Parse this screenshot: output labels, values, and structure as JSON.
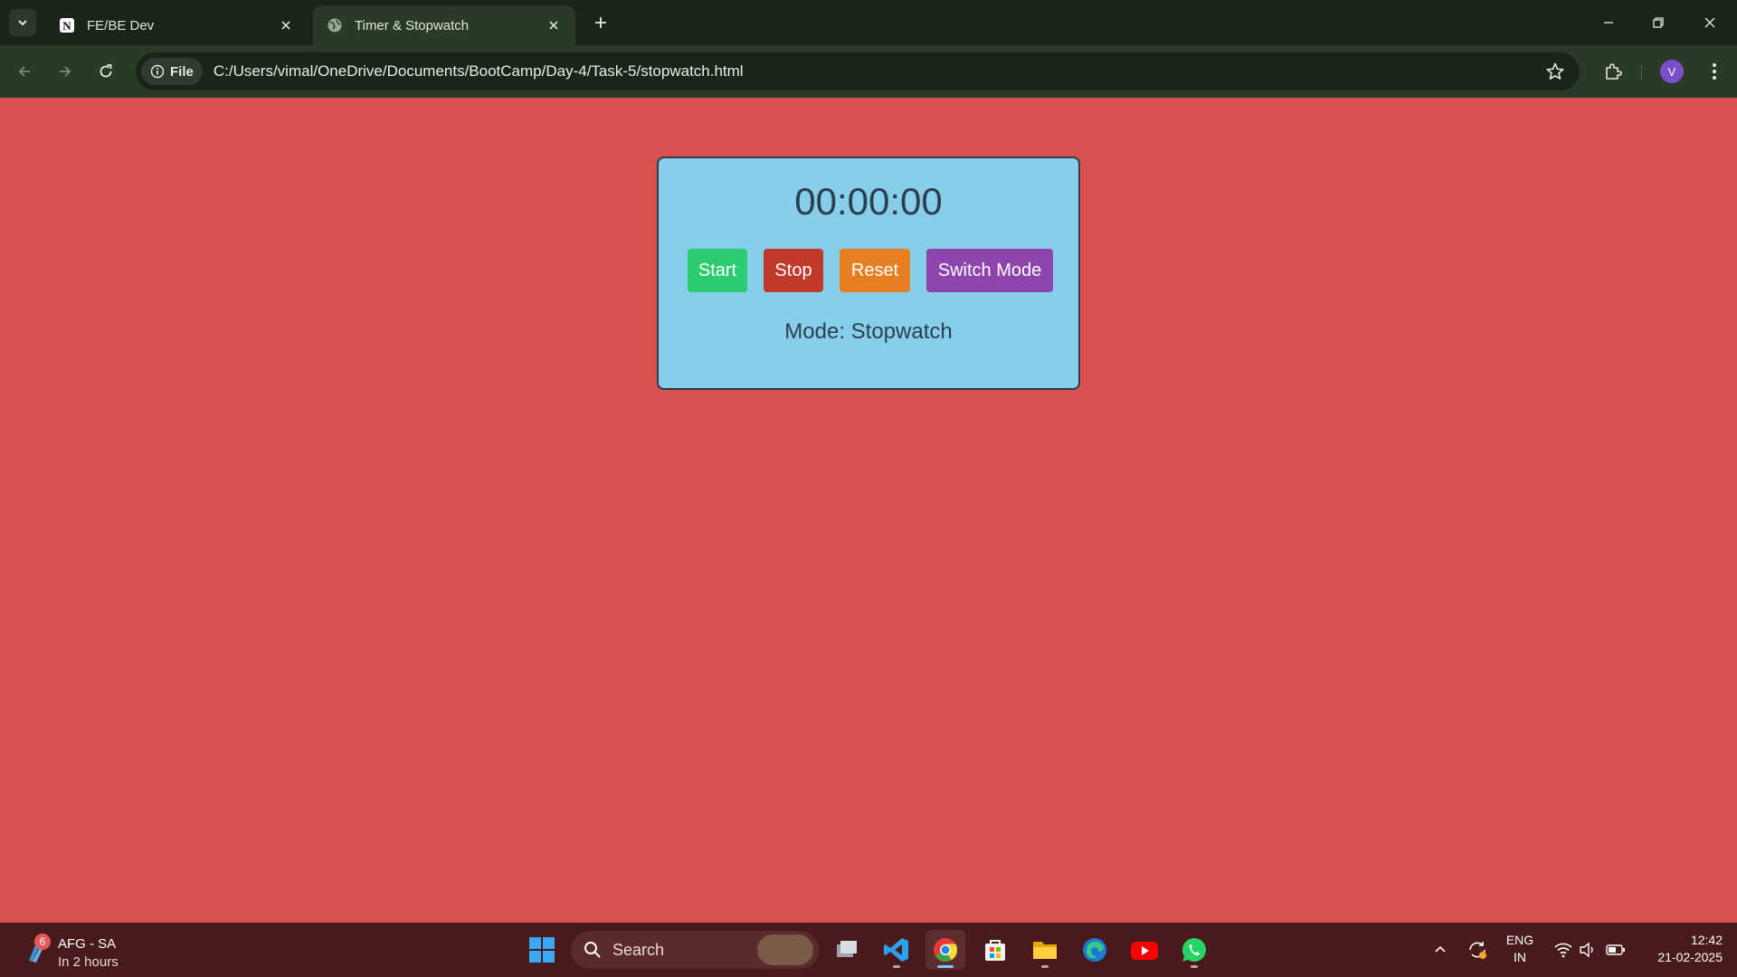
{
  "browser": {
    "tabs": [
      {
        "title": "FE/BE Dev",
        "icon": "notion-icon",
        "active": false
      },
      {
        "title": "Timer & Stopwatch",
        "icon": "globe-icon",
        "active": true
      }
    ],
    "address": {
      "chip_label": "File",
      "url": "C:/Users/vimal/OneDrive/Documents/BootCamp/Day-4/Task-5/stopwatch.html"
    },
    "profile_initial": "V"
  },
  "page": {
    "background": "#d85252",
    "display": "00:00:00",
    "buttons": {
      "start": "Start",
      "stop": "Stop",
      "reset": "Reset",
      "switch_mode": "Switch Mode"
    },
    "mode_text": "Mode: Stopwatch",
    "colors": {
      "card": "#87ceeb",
      "start": "#2ecc71",
      "stop": "#c0392b",
      "reset": "#e67e22",
      "switch_mode": "#8e44ad"
    }
  },
  "taskbar": {
    "weather": {
      "badge": "6",
      "line1": "AFG - SA",
      "line2": "In 2 hours"
    },
    "search_placeholder": "Search",
    "apps": [
      "windows-start-icon",
      "task-view-icon",
      "vscode-icon",
      "chrome-icon",
      "microsoft-store-icon",
      "file-explorer-icon",
      "edge-icon",
      "youtube-icon",
      "whatsapp-icon"
    ],
    "language": {
      "line1": "ENG",
      "line2": "IN"
    },
    "clock": {
      "time": "12:42",
      "date": "21-02-2025"
    }
  }
}
